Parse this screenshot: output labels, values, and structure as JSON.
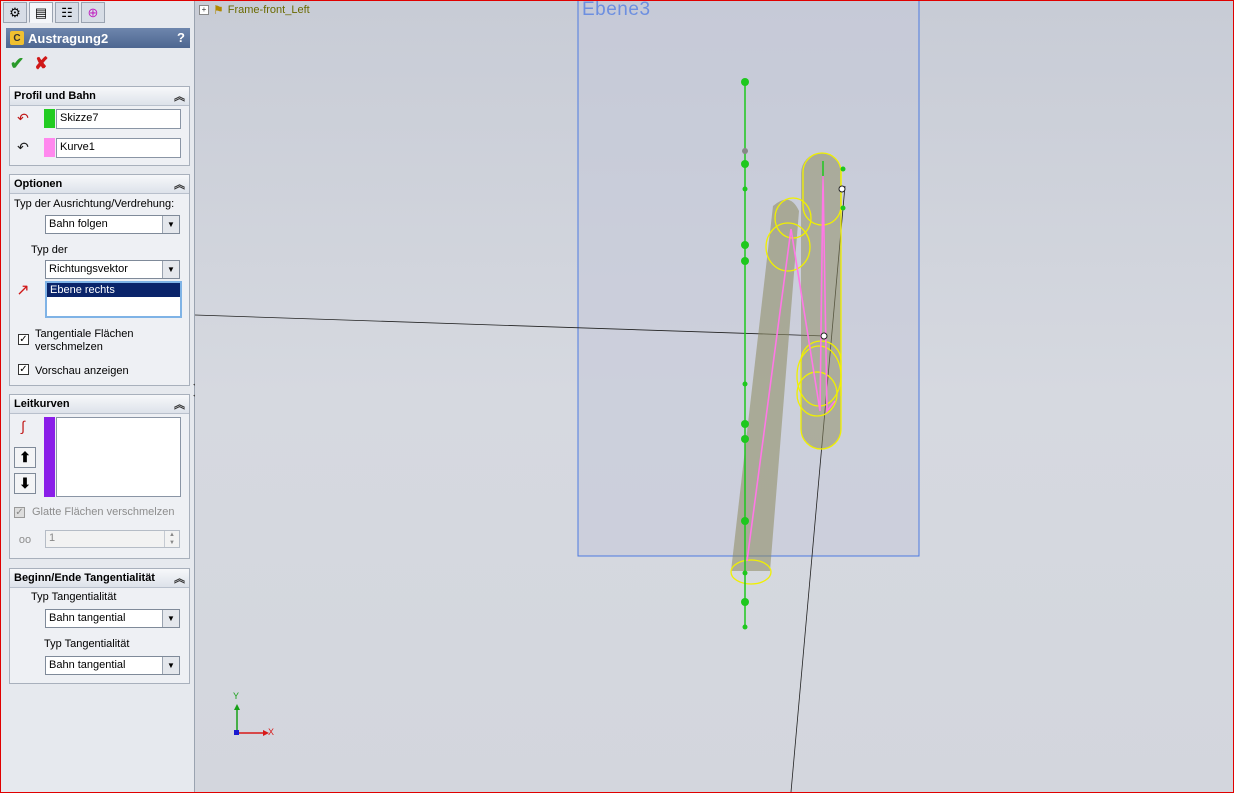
{
  "property_manager": {
    "tabs": [
      "feature-manager-icon",
      "property-manager-icon",
      "configuration-manager-icon",
      "dimxpert-icon"
    ],
    "title": "Austragung2",
    "help": "?",
    "ok": "✔",
    "cancel": "✘"
  },
  "profile_path": {
    "header": "Profil und Bahn",
    "profile_value": "Skizze7",
    "profile_color": "#22cc22",
    "path_value": "Kurve1",
    "path_color": "#ff88ee"
  },
  "options": {
    "header": "Optionen",
    "orientation_label": "Typ der Ausrichtung/Verdrehung:",
    "orientation_value": "Bahn folgen",
    "type_label": "Typ der",
    "type_value": "Richtungsvektor",
    "direction_selection": "Ebene rechts",
    "merge_tangent_label_1": "Tangentiale Flächen",
    "merge_tangent_label_2": "verschmelzen",
    "merge_tangent_checked": true,
    "show_preview_label": "Vorschau anzeigen",
    "show_preview_checked": true
  },
  "guide_curves": {
    "header": "Leitkurven",
    "list_color": "#8a1ee8",
    "merge_smooth_label": "Glatte Flächen verschmelzen",
    "sections_value": "1"
  },
  "tangency": {
    "header": "Beginn/Ende Tangentialität",
    "start_label": "Typ Tangentialität",
    "start_value": "Bahn tangential",
    "end_label": "Typ Tangentialität",
    "end_value": "Bahn tangential"
  },
  "viewport": {
    "tree_item": "Frame-front_Left",
    "plane_label": "Ebene3",
    "triad_y": "Y",
    "triad_x": "X"
  }
}
